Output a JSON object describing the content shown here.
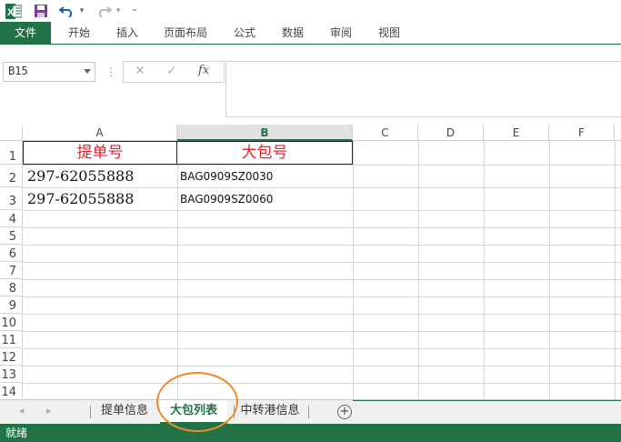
{
  "quick_access": {
    "excel_icon": "excel-logo-icon",
    "save_icon": "save-icon",
    "undo_icon": "undo-icon",
    "redo_icon": "redo-icon",
    "customize_icon": "customize-qat-icon",
    "dropdown_glyph": "▾",
    "customize_glyph": "⁼"
  },
  "ribbon": {
    "tabs": [
      {
        "label": "文件"
      },
      {
        "label": "开始"
      },
      {
        "label": "插入"
      },
      {
        "label": "页面布局"
      },
      {
        "label": "公式"
      },
      {
        "label": "数据"
      },
      {
        "label": "审阅"
      },
      {
        "label": "视图"
      }
    ]
  },
  "formula_bar": {
    "name_box": "B15",
    "separator": "⋮",
    "cancel_glyph": "✕",
    "enter_glyph": "✓",
    "function_glyph": "fx",
    "formula": ""
  },
  "grid": {
    "columns": [
      "A",
      "B",
      "C",
      "D",
      "E",
      "F"
    ],
    "selected_column": "B",
    "rows": [
      "1",
      "2",
      "3",
      "4",
      "5",
      "6",
      "7",
      "8",
      "9",
      "10",
      "11",
      "12",
      "13",
      "14"
    ],
    "header_row": {
      "a": "提单号",
      "b": "大包号"
    },
    "data_rows": [
      {
        "a": "297-62055888",
        "b": "BAG0909SZ0030"
      },
      {
        "a": "297-62055888",
        "b": "BAG0909SZ0060"
      }
    ],
    "header_color": "#e8202a"
  },
  "sheet_tabs": {
    "nav_prev": "◂",
    "nav_next": "▸",
    "tabs": [
      {
        "label": "提单信息",
        "active": false
      },
      {
        "label": "大包列表",
        "active": true
      },
      {
        "label": "中转港信息",
        "active": false
      }
    ],
    "add_glyph": "+"
  },
  "status_bar": {
    "text": "就绪"
  },
  "colors": {
    "accent": "#217346",
    "highlight_circle": "#f08a24"
  }
}
